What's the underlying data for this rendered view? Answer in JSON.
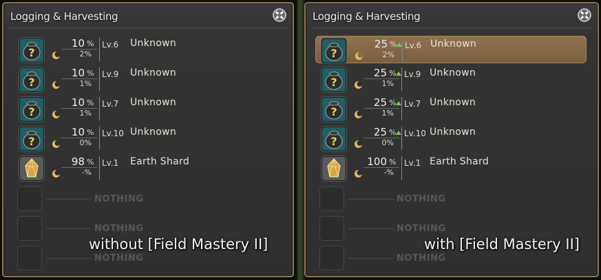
{
  "left_panel": {
    "title": "Logging & Harvesting",
    "items": [
      {
        "chance": "10",
        "hq": "2%",
        "level": "Lv.6",
        "name": "Unknown",
        "icon": "unknown-item-icon"
      },
      {
        "chance": "10",
        "hq": "1%",
        "level": "Lv.9",
        "name": "Unknown",
        "icon": "unknown-item-icon"
      },
      {
        "chance": "10",
        "hq": "1%",
        "level": "Lv.7",
        "name": "Unknown",
        "icon": "unknown-item-icon"
      },
      {
        "chance": "10",
        "hq": "0%",
        "level": "Lv.10",
        "name": "Unknown",
        "icon": "unknown-item-icon"
      },
      {
        "chance": "98",
        "hq": "-%",
        "level": "Lv.1",
        "name": "Earth Shard",
        "icon": "earth-shard-icon"
      }
    ],
    "empty_label": "NOTHING",
    "caption": "without [Field Mastery II]"
  },
  "right_panel": {
    "title": "Logging & Harvesting",
    "items": [
      {
        "chance": "25",
        "hq": "2%",
        "level": "Lv.6",
        "name": "Unknown",
        "icon": "unknown-item-icon",
        "boosted": true
      },
      {
        "chance": "25",
        "hq": "1%",
        "level": "Lv.9",
        "name": "Unknown",
        "icon": "unknown-item-icon",
        "boosted": true
      },
      {
        "chance": "25",
        "hq": "1%",
        "level": "Lv.7",
        "name": "Unknown",
        "icon": "unknown-item-icon",
        "boosted": true
      },
      {
        "chance": "25",
        "hq": "0%",
        "level": "Lv.10",
        "name": "Unknown",
        "icon": "unknown-item-icon",
        "boosted": true
      },
      {
        "chance": "100",
        "hq": "-%",
        "level": "Lv.1",
        "name": "Earth Shard",
        "icon": "earth-shard-icon",
        "boosted": false
      }
    ],
    "empty_label": "NOTHING",
    "caption": "with [Field Mastery II]"
  },
  "percent_sign": "%",
  "colors": {
    "boost_arrow": "#7ec84a",
    "highlight": "#8f7350",
    "frame": "#8c7a4e"
  }
}
